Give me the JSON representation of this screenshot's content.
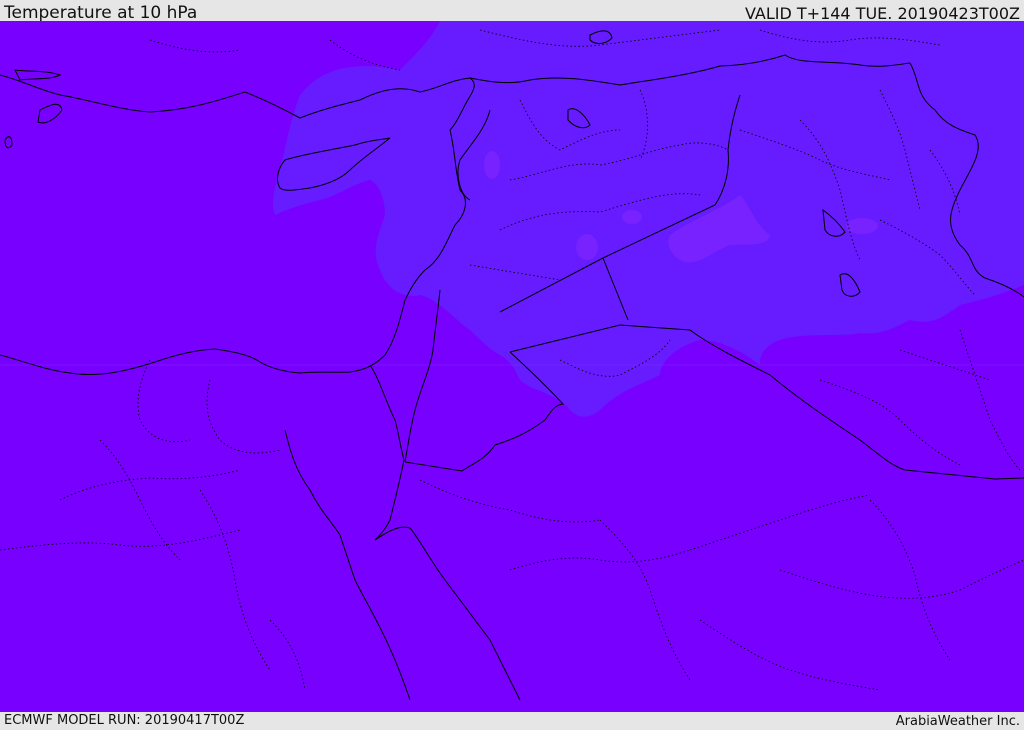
{
  "header": {
    "title": "Temperature at 10 hPa",
    "valid": "VALID T+144 TUE. 20190423T00Z"
  },
  "footer": {
    "model_run": "ECMWF MODEL RUN: 20190417T00Z",
    "credit": "ArabiaWeather Inc."
  },
  "colors": {
    "field_base": "#7700ff",
    "field_warm": "#661cff",
    "field_warmer": "#7722ff",
    "boundary": "#000000",
    "frame": "#e6e6e6"
  }
}
